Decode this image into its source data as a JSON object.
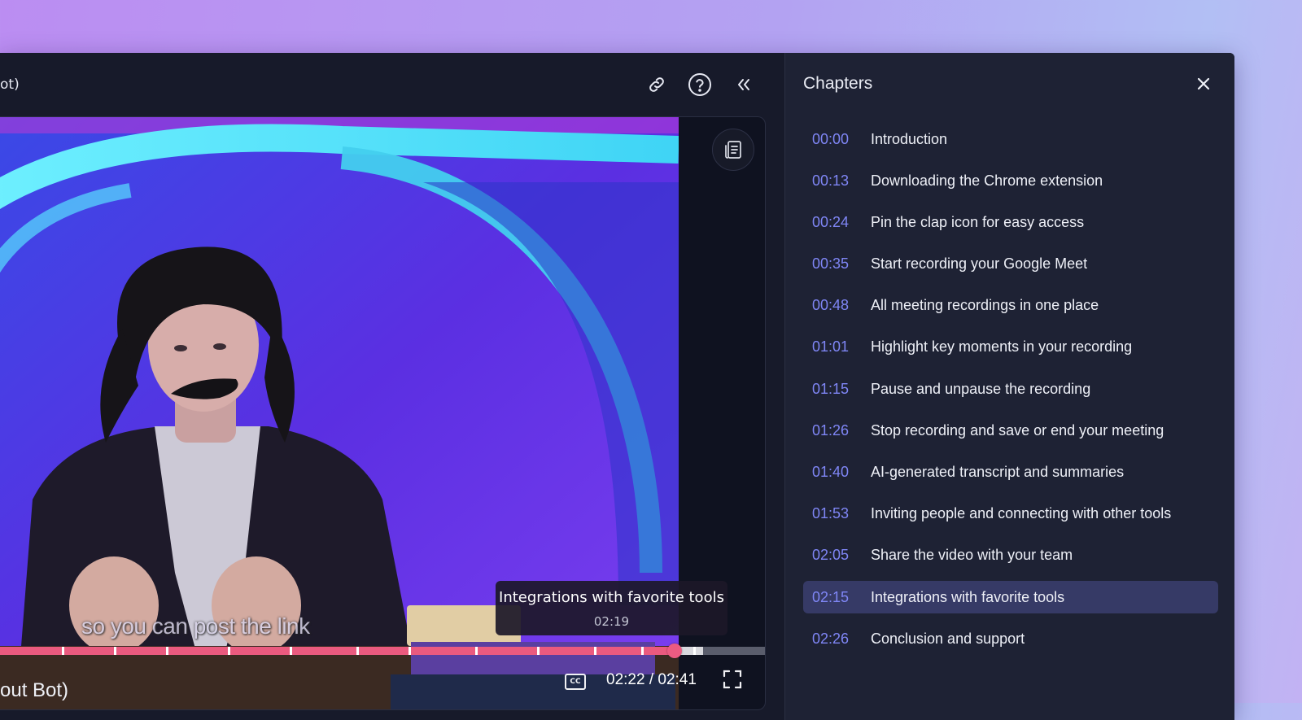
{
  "header": {
    "title_fragment": "ot)",
    "icons": [
      "link-icon",
      "help-icon",
      "collapse-icon"
    ]
  },
  "player": {
    "subtitle": "so you can post the link",
    "tooltip": {
      "title": "Integrations with favorite tools",
      "time": "02:19"
    },
    "time_display": "02:22 / 02:41",
    "cc_label": "CC",
    "progress": {
      "current_seconds": 142,
      "duration_seconds": 161,
      "hover_seconds": 139,
      "buffered_seconds": 148
    },
    "accent": "#ea5a7f"
  },
  "page": {
    "bottom_title_fragment": "out Bot)"
  },
  "chapters": {
    "title": "Chapters",
    "accent": "#7f86f5",
    "items": [
      {
        "time": "00:00",
        "label": "Introduction"
      },
      {
        "time": "00:13",
        "label": "Downloading the Chrome extension"
      },
      {
        "time": "00:24",
        "label": "Pin the clap icon for easy access"
      },
      {
        "time": "00:35",
        "label": "Start recording your Google Meet"
      },
      {
        "time": "00:48",
        "label": "All meeting recordings in one place"
      },
      {
        "time": "01:01",
        "label": "Highlight key moments in your recording"
      },
      {
        "time": "01:15",
        "label": "Pause and unpause the recording"
      },
      {
        "time": "01:26",
        "label": "Stop recording and save or end your meeting"
      },
      {
        "time": "01:40",
        "label": "AI-generated transcript and summaries"
      },
      {
        "time": "01:53",
        "label": "Inviting people and connecting with other tools"
      },
      {
        "time": "02:05",
        "label": "Share the video with your team"
      },
      {
        "time": "02:15",
        "label": "Integrations with favorite tools",
        "active": true
      },
      {
        "time": "02:26",
        "label": "Conclusion and support"
      }
    ]
  }
}
